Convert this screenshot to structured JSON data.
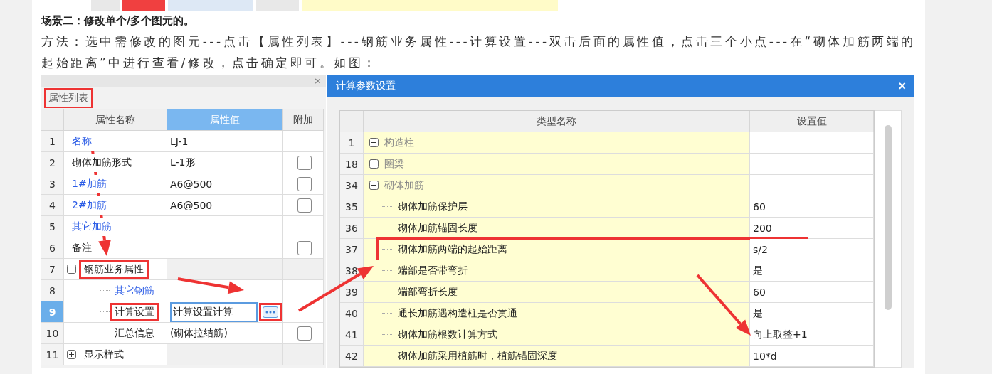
{
  "heading": "场景二：修改单个/多个图元的。",
  "paragraph": "方法：选中需修改的图元---点击【属性列表】---钢筋业务属性---计算设置---双击后面的属性值，点击三个小点---在“砌体加筋两端的起始距离”中进行查看/修改，点击确定即可。如图：",
  "property_panel": {
    "close": "×",
    "title": "属性列表",
    "title_highlighted": true,
    "columns": [
      "属性名称",
      "属性值",
      "附加"
    ],
    "rows": [
      {
        "num": "1",
        "name": "名称",
        "link": true,
        "value": "LJ-1"
      },
      {
        "num": "2",
        "name": "砌体加筋形式",
        "link": false,
        "value": "L-1形",
        "checked": false
      },
      {
        "num": "3",
        "name": "1#加筋",
        "link": true,
        "value": "A6@500",
        "checked": false
      },
      {
        "num": "4",
        "name": "2#加筋",
        "link": true,
        "value": "A6@500",
        "checked": false
      },
      {
        "num": "5",
        "name": "其它加筋",
        "link": true
      },
      {
        "num": "6",
        "name": "备注",
        "link": false,
        "checked": false
      },
      {
        "num": "7",
        "name": "钢筋业务属性",
        "link": false,
        "expanded": true,
        "highlighted": true,
        "children": [
          {
            "num": "8",
            "name": "其它钢筋",
            "link": true
          },
          {
            "num": "9",
            "name": "计算设置",
            "link": false,
            "highlighted": true,
            "selected": true,
            "value": "计算设置计算",
            "editing": true,
            "button_highlighted": true
          },
          {
            "num": "10",
            "name": "汇总信息",
            "link": false,
            "value": "(砌体拉结筋)",
            "checked": false
          }
        ]
      },
      {
        "num": "11",
        "name": "显示样式",
        "link": false,
        "expanded": false,
        "children": []
      }
    ]
  },
  "dialog": {
    "title": "计算参数设置",
    "close": "×",
    "columns": [
      "类型名称",
      "设置值"
    ],
    "rows": [
      {
        "num": "1",
        "name": "构造柱",
        "expanded": false
      },
      {
        "num": "18",
        "name": "圈梁",
        "expanded": false
      },
      {
        "num": "34",
        "name": "砌体加筋",
        "expanded": true,
        "children": [
          {
            "num": "35",
            "name": "砌体加筋保护层",
            "value": "60"
          },
          {
            "num": "36",
            "name": "砌体加筋锚固长度",
            "value": "200"
          },
          {
            "num": "37",
            "name": "砌体加筋两端的起始距离",
            "value": "s/2",
            "highlighted": true
          },
          {
            "num": "38",
            "name": "端部是否带弯折",
            "value": "是"
          },
          {
            "num": "39",
            "name": "端部弯折长度",
            "value": "60"
          },
          {
            "num": "40",
            "name": "通长加筋遇构造柱是否贯通",
            "value": "是"
          },
          {
            "num": "41",
            "name": "砌体加筋根数计算方式",
            "value": "向上取整+1"
          },
          {
            "num": "42",
            "name": "砌体加筋采用植筋时，植筋锚固深度",
            "value": "10*d"
          }
        ]
      }
    ]
  }
}
